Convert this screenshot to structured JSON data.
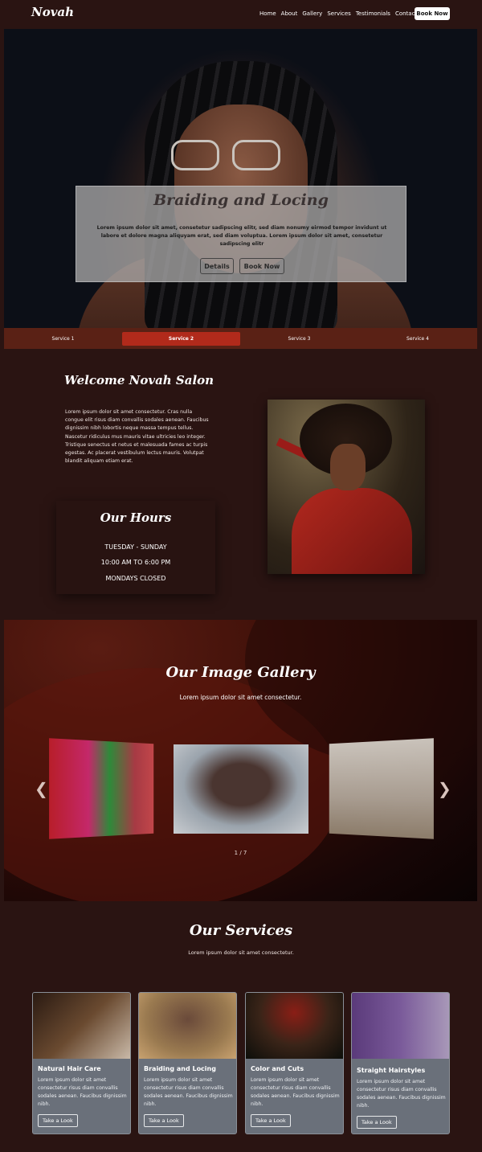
{
  "nav": {
    "logo": "Novah",
    "links": [
      "Home",
      "About",
      "Gallery",
      "Services",
      "Testimonials",
      "Contact"
    ],
    "cta": "Book Now"
  },
  "hero": {
    "title": "Braiding and Locing",
    "text": "Lorem ipsum dolor sit amet, consetetur sadipscing elitr, sed diam nonumy eirmod tempor invidunt ut labore et dolore magna aliquyam erat, sed diam voluptua. Lorem ipsum dolor sit amet, consetetur sadipscing elitr",
    "details_label": "Details",
    "book_label": "Book Now"
  },
  "tabs": [
    "Service 1",
    "Service 2",
    "Service 3",
    "Service 4"
  ],
  "welcome": {
    "title": "Welcome Novah Salon",
    "text": "Lorem ipsum dolor sit amet consectetur. Cras nulla congue elit risus diam convallis sodales aenean. Faucibus dignissim nibh lobortis neque massa tempus tellus. Nascetur ridiculus mus mauris vitae ultricies leo integer. Tristique senectus et netus et malesuada fames ac turpis egestas. Ac placerat vestibulum lectus mauris. Volutpat blandit aliquam etiam erat."
  },
  "hours": {
    "title": "Our Hours",
    "line1": "TUESDAY - SUNDAY",
    "line2": "10:00 AM TO 6:00 PM",
    "line3": "MONDAYS CLOSED"
  },
  "gallery": {
    "title": "Our Image Gallery",
    "subtitle": "Lorem ipsum dolor sit amet consectetur.",
    "counter": "1 / 7",
    "prev_icon": "chevron-left-icon",
    "next_icon": "chevron-right-icon"
  },
  "services": {
    "title": "Our Services",
    "subtitle": "Lorem ipsum dolor sit amet consectetur.",
    "cards": [
      {
        "title": "Natural Hair Care",
        "text": "Lorem ipsum dolor sit amet consectetur risus diam convallis sodales aenean. Faucibus dignissim nibh.",
        "button": "Take a Look"
      },
      {
        "title": "Braiding and Locing",
        "text": "Lorem ipsum dolor sit amet consectetur risus diam convallis sodales aenean. Faucibus dignissim nibh.",
        "button": "Take a Look"
      },
      {
        "title": "Color and Cuts",
        "text": "Lorem ipsum dolor sit amet consectetur risus diam convallis sodales aenean. Faucibus dignissim nibh.",
        "button": "Take a Look"
      },
      {
        "title": "Straight Hairstyles",
        "text": "Lorem ipsum dolor sit amet consectetur risus diam convallis sodales aenean. Faucibus dignissim nibh.",
        "button": "Take a Look"
      }
    ]
  },
  "colors": {
    "background": "#2a1412",
    "tab_bar": "#5a2115",
    "tab_active": "#b12a1b",
    "card": "#6a707a"
  }
}
